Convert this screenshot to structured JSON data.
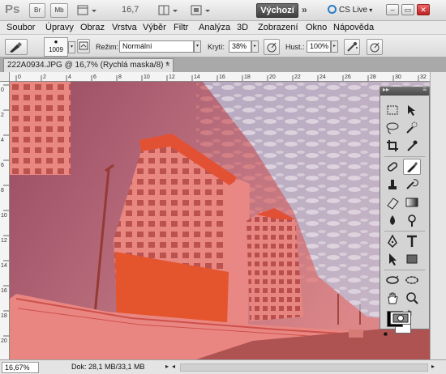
{
  "appbar": {
    "logo": "Ps",
    "bridge_label": "Br",
    "minibridge_label": "Mb",
    "zoom": "16,7",
    "workspace": "Výchozí",
    "more": "»",
    "cslive": "CS Live",
    "minimize": "–",
    "restore": "▭",
    "close": "✕"
  },
  "menu": [
    "Soubor",
    "Úpravy",
    "Obraz",
    "Vrstva",
    "Výběr",
    "Filtr",
    "Analýza",
    "3D",
    "Zobrazení",
    "Okno",
    "Nápověda"
  ],
  "options": {
    "brush_size": "1009",
    "mode_label": "Režim:",
    "mode_value": "Normální",
    "opacity_label": "Krytí:",
    "opacity_value": "38%",
    "flow_label": "Hust.:",
    "flow_value": "100%"
  },
  "document": {
    "tab_title": "222A0934.JPG @ 16,7% (Rychlá maska/8) *",
    "tab_close": "×"
  },
  "ruler_top_labels": [
    "0",
    "2",
    "4",
    "6",
    "8",
    "10",
    "12",
    "14",
    "16",
    "18",
    "20",
    "22",
    "24",
    "26",
    "28",
    "30",
    "32"
  ],
  "ruler_left_labels": [
    "0",
    "2",
    "4",
    "6",
    "8",
    "10",
    "12",
    "14",
    "16",
    "18",
    "20"
  ],
  "tools_panel": {
    "collapse": "▸▸",
    "menu": "≡",
    "swap": "↰",
    "default_colors": "■"
  },
  "colors": {
    "quick_mask": "#e23a32",
    "sky": "#8fb4dc",
    "foreground": "#000000",
    "background": "#ffffff"
  },
  "status": {
    "zoom": "16,67%",
    "doc_size": "Dok: 28,1 MB/33,1 MB",
    "arrow": "▸",
    "scroll_left": "◂",
    "scroll_right": "▸"
  }
}
